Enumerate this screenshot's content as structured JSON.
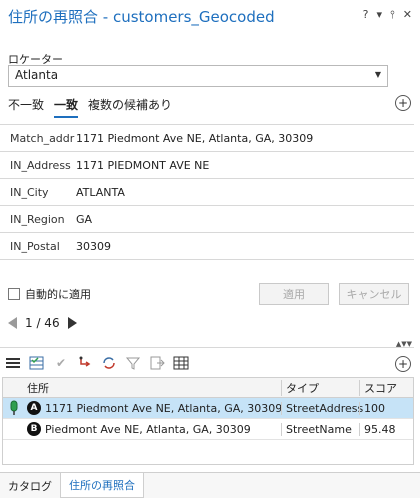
{
  "window": {
    "title": "住所の再照合 - customers_Geocoded",
    "controls": [
      "?",
      "▾",
      "⫯",
      "✕"
    ]
  },
  "locator": {
    "label": "ロケーター",
    "value": "Atlanta"
  },
  "tabs": [
    "不一致",
    "一致",
    "複数の候補あり"
  ],
  "attributes": [
    {
      "key": "Match_addr",
      "value": "1171 Piedmont Ave NE, Atlanta, GA, 30309"
    },
    {
      "key": "IN_Address",
      "value": "1171 PIEDMONT AVE NE"
    },
    {
      "key": "IN_City",
      "value": "ATLANTA"
    },
    {
      "key": "IN_Region",
      "value": "GA"
    },
    {
      "key": "IN_Postal",
      "value": "30309"
    }
  ],
  "actions": {
    "auto_apply": "自動的に適用",
    "apply": "適用",
    "cancel": "キャンセル"
  },
  "pager": {
    "text": "1 / 46"
  },
  "candidates": {
    "headers": [
      "住所",
      "タイプ",
      "スコア"
    ],
    "rows": [
      {
        "badge": "A",
        "address": "1171 Piedmont Ave NE, Atlanta, GA, 30309",
        "type": "StreetAddress",
        "score": "100"
      },
      {
        "badge": "B",
        "address": "Piedmont Ave NE, Atlanta, GA, 30309",
        "type": "StreetName",
        "score": "95.48"
      }
    ]
  },
  "bottom_tabs": [
    "カタログ",
    "住所の再照合"
  ],
  "colors": {
    "accent": "#1e6fbe",
    "selected_row": "#c6e3f7",
    "pin": "#2e9e4f"
  }
}
